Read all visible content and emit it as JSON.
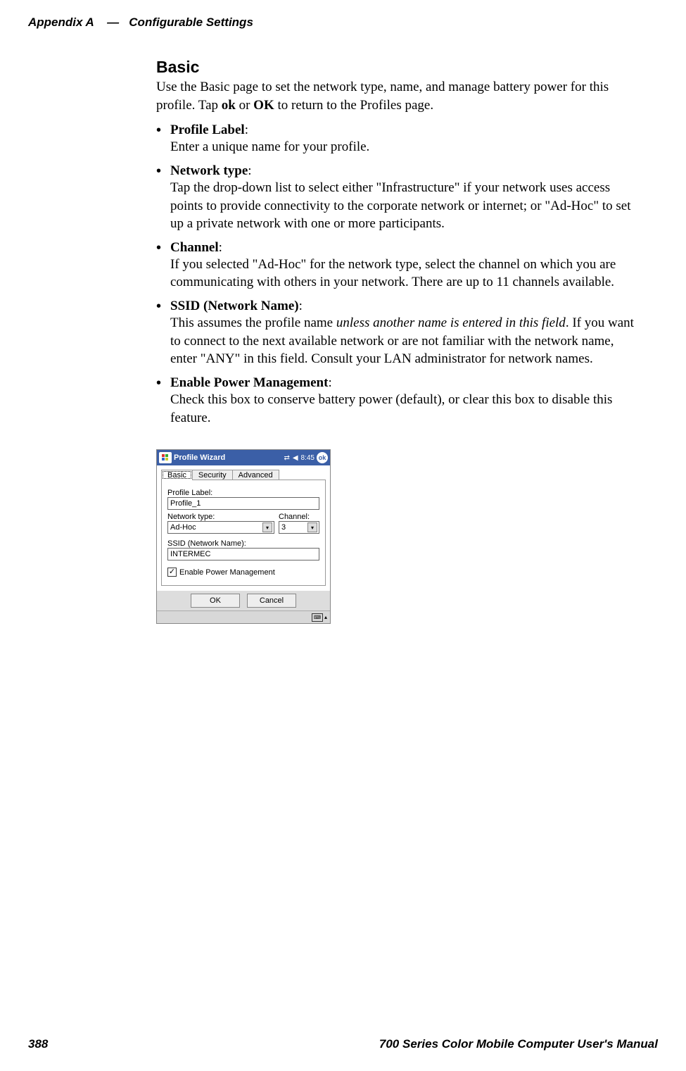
{
  "header": {
    "appendix": "Appendix  A",
    "dash": "—",
    "title": "Configurable Settings"
  },
  "section": {
    "heading": "Basic",
    "intro_pre": "Use the Basic page to set the network type, name, and manage battery power for this profile. Tap ",
    "intro_ok1": "ok",
    "intro_mid": " or ",
    "intro_ok2": "OK",
    "intro_post": " to return to the Profiles page."
  },
  "items": [
    {
      "term": "Profile Label",
      "colon": ":",
      "desc": "Enter a unique name for your profile."
    },
    {
      "term": "Network type",
      "colon": ":",
      "desc": "Tap the drop-down list to select either \"Infrastructure\" if your network uses access points to provide connectivity to the corporate network or internet; or \"Ad-Hoc\" to set up a private network with one or more participants."
    },
    {
      "term": "Channel",
      "colon": ":",
      "desc": "If you selected \"Ad-Hoc\" for the network type, select the channel on which you are communicating with others in your network. There are up to 11 channels available."
    },
    {
      "term": "SSID (Network Name)",
      "colon": ":",
      "desc_pre": "This assumes the profile name ",
      "desc_em": "unless another name is entered in this field",
      "desc_post": ". If you want to connect to the next available network or are not familiar with the network name, enter \"ANY\" in this field. Consult your LAN administrator for network names."
    },
    {
      "term": "Enable Power Management",
      "colon": ":",
      "desc": "Check this box to conserve battery power (default), or clear this box to disable this feature."
    }
  ],
  "shot": {
    "titlebar": {
      "app": "Profile Wizard",
      "time": "8:45",
      "ok": "ok"
    },
    "tabs": {
      "basic": "Basic",
      "security": "Security",
      "advanced": "Advanced"
    },
    "form": {
      "profile_label_lbl": "Profile Label:",
      "profile_label_val": "Profile_1",
      "network_type_lbl": "Network type:",
      "network_type_val": "Ad-Hoc",
      "channel_lbl": "Channel:",
      "channel_val": "3",
      "ssid_lbl": "SSID (Network Name):",
      "ssid_val": "INTERMEC",
      "epm_label": "Enable Power Management",
      "epm_checked": "✓"
    },
    "buttons": {
      "ok": "OK",
      "cancel": "Cancel"
    }
  },
  "footer": {
    "page": "388",
    "manual": "700 Series Color Mobile Computer User's Manual"
  }
}
